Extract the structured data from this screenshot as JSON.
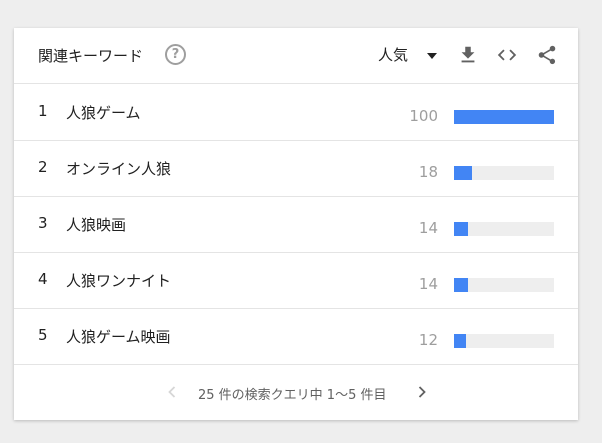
{
  "header": {
    "title": "関連キーワード",
    "help_glyph": "?",
    "dropdown_selected": "人気"
  },
  "rows": [
    {
      "rank": "1",
      "term": "人狼ゲーム",
      "value": 100
    },
    {
      "rank": "2",
      "term": "オンライン人狼",
      "value": 18
    },
    {
      "rank": "3",
      "term": "人狼映画",
      "value": 14
    },
    {
      "rank": "4",
      "term": "人狼ワンナイト",
      "value": 14
    },
    {
      "rank": "5",
      "term": "人狼ゲーム映画",
      "value": 12
    }
  ],
  "pager": {
    "text": "25 件の検索クエリ中 1〜5 件目"
  },
  "colors": {
    "bar": "#4285f4",
    "track": "#eeeeee",
    "value_text": "#9e9e9e"
  },
  "icons": {
    "help": "help-circle-icon",
    "dropdown": "caret-down-icon",
    "download": "download-icon",
    "embed": "code-icon",
    "share": "share-icon",
    "prev": "chevron-left-icon",
    "next": "chevron-right-icon"
  }
}
